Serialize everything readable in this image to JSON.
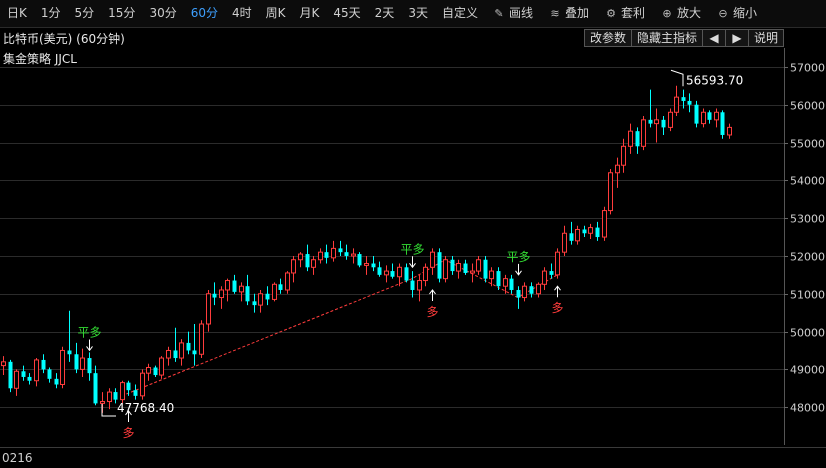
{
  "toolbar": {
    "periods": [
      {
        "label": "日K",
        "name": "period-daily"
      },
      {
        "label": "1分",
        "name": "period-1min"
      },
      {
        "label": "5分",
        "name": "period-5min"
      },
      {
        "label": "15分",
        "name": "period-15min"
      },
      {
        "label": "30分",
        "name": "period-30min"
      },
      {
        "label": "60分",
        "name": "period-60min",
        "active": true
      },
      {
        "label": "4时",
        "name": "period-4h"
      },
      {
        "label": "周K",
        "name": "period-weekly"
      },
      {
        "label": "月K",
        "name": "period-monthly"
      },
      {
        "label": "45天",
        "name": "period-45d"
      },
      {
        "label": "2天",
        "name": "period-2d"
      },
      {
        "label": "3天",
        "name": "period-3d"
      },
      {
        "label": "自定义",
        "name": "period-custom"
      }
    ],
    "tools": [
      {
        "label": "画线",
        "icon": "pen-icon",
        "glyph": "✎"
      },
      {
        "label": "叠加",
        "icon": "stack-icon",
        "glyph": "≋"
      },
      {
        "label": "套利",
        "icon": "arbitrage-icon",
        "glyph": "⚙"
      },
      {
        "label": "放大",
        "icon": "zoom-in-icon",
        "glyph": "⊕"
      },
      {
        "label": "缩小",
        "icon": "zoom-out-icon",
        "glyph": "⊖"
      }
    ],
    "active_color": "#3ea0ff"
  },
  "header": {
    "title": "比特币(美元) (60分钟)",
    "buttons": {
      "params": "改参数",
      "hide_indicator": "隐藏主指标",
      "prev": "◀",
      "next": "▶",
      "help": "说明"
    }
  },
  "indicator": {
    "name": "集金策略 JJCL"
  },
  "bottom": {
    "label": "0216"
  },
  "colors": {
    "up": "#ff3c3c",
    "down": "#00ffff",
    "buy_signal": "#ff3c3c",
    "close_signal": "#33dd33",
    "axis_text": "#d0d0d0"
  },
  "chart_data": {
    "type": "candlestick",
    "y_axis_labels": [
      "57000.0",
      "56000.0",
      "55000.0",
      "54000.0",
      "53000.0",
      "52000.0",
      "51000.0",
      "50000.0",
      "49000.0",
      "48000.0"
    ],
    "y_axis_values": [
      57000,
      56000,
      55000,
      54000,
      53000,
      52000,
      51000,
      50000,
      49000,
      48000
    ],
    "ylim": [
      47000,
      57500
    ],
    "grid": true,
    "candles": [
      [
        49100,
        49350,
        48850,
        49200
      ],
      [
        49200,
        49250,
        48400,
        48500
      ],
      [
        48500,
        49000,
        48300,
        48950
      ],
      [
        48950,
        49100,
        48700,
        48800
      ],
      [
        48800,
        48900,
        48600,
        48700
      ],
      [
        48700,
        49300,
        48550,
        49250
      ],
      [
        49250,
        49400,
        48900,
        49000
      ],
      [
        49000,
        49050,
        48650,
        48750
      ],
      [
        48750,
        48900,
        48500,
        48600
      ],
      [
        48600,
        49600,
        48500,
        49500
      ],
      [
        49500,
        50550,
        49200,
        49400
      ],
      [
        49400,
        49700,
        48900,
        49000
      ],
      [
        49000,
        49550,
        48800,
        49300
      ],
      [
        49300,
        49450,
        48700,
        48900
      ],
      [
        48900,
        49100,
        48050,
        48100
      ],
      [
        48100,
        48400,
        47850,
        48150
      ],
      [
        48150,
        48500,
        47950,
        48400
      ],
      [
        48400,
        48500,
        48100,
        48200
      ],
      [
        48200,
        48700,
        48100,
        48650
      ],
      [
        48650,
        48700,
        48300,
        48450
      ],
      [
        48450,
        48600,
        48200,
        48300
      ],
      [
        48300,
        49000,
        48200,
        48900
      ],
      [
        48900,
        49150,
        48700,
        49050
      ],
      [
        49050,
        49100,
        48800,
        48850
      ],
      [
        48850,
        49350,
        48750,
        49300
      ],
      [
        49300,
        49600,
        49100,
        49500
      ],
      [
        49500,
        50100,
        49200,
        49300
      ],
      [
        49300,
        49800,
        49100,
        49700
      ],
      [
        49700,
        50000,
        49400,
        49500
      ],
      [
        49500,
        50200,
        49100,
        49400
      ],
      [
        49400,
        50300,
        49300,
        50200
      ],
      [
        50200,
        51100,
        50000,
        51000
      ],
      [
        51000,
        51300,
        50700,
        50900
      ],
      [
        50900,
        51200,
        50600,
        51100
      ],
      [
        51100,
        51400,
        50800,
        51350
      ],
      [
        51350,
        51500,
        51000,
        51050
      ],
      [
        51050,
        51300,
        50800,
        51200
      ],
      [
        51200,
        51500,
        50700,
        50800
      ],
      [
        50800,
        51000,
        50500,
        50700
      ],
      [
        50700,
        51100,
        50500,
        51000
      ],
      [
        51000,
        51200,
        50700,
        50850
      ],
      [
        50850,
        51300,
        50800,
        51250
      ],
      [
        51250,
        51400,
        51000,
        51100
      ],
      [
        51100,
        51600,
        51000,
        51550
      ],
      [
        51550,
        52000,
        51300,
        51900
      ],
      [
        51900,
        52100,
        51700,
        52050
      ],
      [
        52050,
        52300,
        51600,
        51700
      ],
      [
        51700,
        52000,
        51500,
        51900
      ],
      [
        51900,
        52200,
        51800,
        52100
      ],
      [
        52100,
        52300,
        51800,
        51950
      ],
      [
        51950,
        52400,
        51850,
        52200
      ],
      [
        52200,
        52400,
        52000,
        52100
      ],
      [
        52100,
        52300,
        51900,
        52000
      ],
      [
        52000,
        52200,
        51800,
        52050
      ],
      [
        52050,
        52100,
        51700,
        51750
      ],
      [
        51750,
        52000,
        51500,
        51800
      ],
      [
        51800,
        52000,
        51600,
        51700
      ],
      [
        51700,
        51850,
        51450,
        51500
      ],
      [
        51500,
        51750,
        51300,
        51600
      ],
      [
        51600,
        51800,
        51400,
        51450
      ],
      [
        51450,
        51800,
        51200,
        51700
      ],
      [
        51700,
        51800,
        51300,
        51350
      ],
      [
        51350,
        51600,
        50900,
        51100
      ],
      [
        51100,
        51500,
        50800,
        51350
      ],
      [
        51350,
        51800,
        51200,
        51700
      ],
      [
        51700,
        52200,
        51500,
        52100
      ],
      [
        52100,
        52200,
        51300,
        51400
      ],
      [
        51400,
        52000,
        51300,
        51900
      ],
      [
        51900,
        52000,
        51500,
        51600
      ],
      [
        51600,
        51900,
        51400,
        51800
      ],
      [
        51800,
        51900,
        51500,
        51550
      ],
      [
        51550,
        51800,
        51300,
        51600
      ],
      [
        51600,
        52000,
        51500,
        51900
      ],
      [
        51900,
        52000,
        51300,
        51400
      ],
      [
        51400,
        51700,
        51200,
        51600
      ],
      [
        51600,
        51700,
        51100,
        51200
      ],
      [
        51200,
        51500,
        51000,
        51400
      ],
      [
        51400,
        51500,
        51000,
        51100
      ],
      [
        51100,
        51200,
        50600,
        50900
      ],
      [
        50900,
        51300,
        50800,
        51200
      ],
      [
        51200,
        51300,
        50900,
        51000
      ],
      [
        51000,
        51300,
        50900,
        51250
      ],
      [
        51250,
        51700,
        51100,
        51600
      ],
      [
        51600,
        51800,
        51400,
        51500
      ],
      [
        51500,
        52200,
        51400,
        52100
      ],
      [
        52100,
        52800,
        52000,
        52600
      ],
      [
        52600,
        52900,
        52300,
        52400
      ],
      [
        52400,
        52800,
        52300,
        52700
      ],
      [
        52700,
        52800,
        52500,
        52600
      ],
      [
        52600,
        52850,
        52450,
        52750
      ],
      [
        52750,
        52900,
        52400,
        52500
      ],
      [
        52500,
        53300,
        52400,
        53200
      ],
      [
        53200,
        54300,
        53100,
        54200
      ],
      [
        54200,
        54600,
        53800,
        54400
      ],
      [
        54400,
        55100,
        54200,
        54900
      ],
      [
        54900,
        55500,
        54700,
        55300
      ],
      [
        55300,
        55400,
        54700,
        54900
      ],
      [
        54900,
        55700,
        54800,
        55600
      ],
      [
        55600,
        56400,
        55400,
        55500
      ],
      [
        55500,
        55900,
        55000,
        55600
      ],
      [
        55600,
        55700,
        55200,
        55400
      ],
      [
        55400,
        55900,
        55300,
        55800
      ],
      [
        55800,
        56500,
        55700,
        56200
      ],
      [
        56200,
        56400,
        55900,
        56100
      ],
      [
        56100,
        56300,
        55800,
        56000
      ],
      [
        56000,
        56100,
        55400,
        55500
      ],
      [
        55500,
        55900,
        55400,
        55800
      ],
      [
        55800,
        55850,
        55500,
        55600
      ],
      [
        55600,
        55900,
        55400,
        55800
      ],
      [
        55800,
        55850,
        55100,
        55200
      ],
      [
        55200,
        55500,
        55100,
        55400
      ]
    ],
    "dashed_line": [
      [
        18,
        48300
      ],
      [
        62,
        51400
      ],
      [
        67,
        51900
      ],
      [
        78,
        50900
      ],
      [
        84,
        51500
      ]
    ],
    "signals": [
      {
        "type": "平多",
        "index": 13,
        "price": 49500,
        "dir": "down"
      },
      {
        "type": "多",
        "index": 19,
        "price": 47900,
        "dir": "up"
      },
      {
        "type": "平多",
        "index": 62,
        "price": 51700,
        "dir": "down"
      },
      {
        "type": "多",
        "index": 65,
        "price": 51100,
        "dir": "up"
      },
      {
        "type": "平多",
        "index": 78,
        "price": 51500,
        "dir": "down"
      },
      {
        "type": "多",
        "index": 84,
        "price": 51200,
        "dir": "up"
      }
    ],
    "low_label": {
      "text": "47768.40",
      "index": 15,
      "price": 47768.4
    },
    "high_label": {
      "text": "56593.70",
      "index": 103,
      "price": 56593.7
    }
  }
}
